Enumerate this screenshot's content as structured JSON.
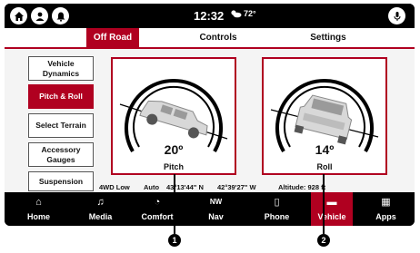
{
  "header": {
    "time": "12:32",
    "weather_icon": "partly-cloudy-icon",
    "temperature": "72°"
  },
  "top_icons": [
    "home-icon",
    "person-icon",
    "notification-icon",
    "microphone-icon"
  ],
  "tabs": [
    {
      "label": "Off Road"
    },
    {
      "label": "Controls"
    },
    {
      "label": "Settings"
    }
  ],
  "sidebar": {
    "items": [
      {
        "label": "Vehicle Dynamics"
      },
      {
        "label": "Pitch & Roll"
      },
      {
        "label": "Select Terrain"
      },
      {
        "label": "Accessory Gauges"
      },
      {
        "label": "Suspension"
      }
    ]
  },
  "pitch": {
    "angle": "20º",
    "label": "Pitch"
  },
  "roll": {
    "angle": "14º",
    "label": "Roll"
  },
  "status": {
    "drive_mode": "4WD Low",
    "mode": "Auto",
    "latitude": "43°13'44\" N",
    "longitude": "42°39'27\" W",
    "altitude": "Altitude: 928 ft"
  },
  "nav": [
    {
      "icon": "home-icon",
      "label": "Home",
      "glyph": "⌂"
    },
    {
      "icon": "music-icon",
      "label": "Media",
      "glyph": "♫"
    },
    {
      "icon": "comfort-icon",
      "label": "Comfort",
      "glyph": "◔"
    },
    {
      "icon": "compass-icon",
      "label": "Nav",
      "glyph": "NW"
    },
    {
      "icon": "phone-icon",
      "label": "Phone",
      "glyph": "▯"
    },
    {
      "icon": "car-icon",
      "label": "Vehicle",
      "glyph": "▬"
    },
    {
      "icon": "apps-grid-icon",
      "label": "Apps",
      "glyph": "▦"
    }
  ],
  "callouts": [
    "1",
    "2"
  ],
  "colors": {
    "accent": "#b00020",
    "bar": "#000000"
  }
}
